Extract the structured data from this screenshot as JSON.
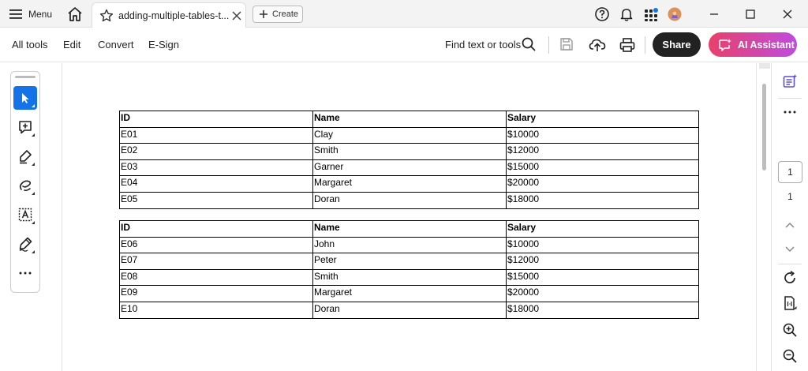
{
  "titlebar": {
    "menu_label": "Menu",
    "tab_title": "adding-multiple-tables-t...",
    "create_label": "Create",
    "icons": [
      "hamburger-icon",
      "home-icon",
      "star-icon",
      "close-icon",
      "plus-icon",
      "help-icon",
      "bell-icon",
      "apps-icon",
      "avatar",
      "minimize-icon",
      "maximize-icon",
      "window-close-icon"
    ]
  },
  "toolbar": {
    "menu_items": [
      "All tools",
      "Edit",
      "Convert",
      "E-Sign"
    ],
    "find_label": "Find text or tools",
    "share_label": "Share",
    "ai_label": "AI Assistant",
    "icons": [
      "search-icon",
      "save-icon",
      "upload-icon",
      "print-icon",
      "ai-chat-icon"
    ]
  },
  "left_rail": {
    "tools": [
      "select-cursor-icon",
      "add-comment-icon",
      "highlighter-icon",
      "draw-freeform-icon",
      "text-box-icon",
      "sign-pen-icon",
      "more-tools-icon"
    ],
    "active_tool": "select-cursor-icon"
  },
  "document": {
    "tables": [
      {
        "header": [
          "ID",
          "Name",
          "Salary"
        ],
        "rows": [
          [
            "E01",
            "Clay",
            "$10000"
          ],
          [
            "E02",
            "Smith",
            "$12000"
          ],
          [
            "E03",
            "Garner",
            "$15000"
          ],
          [
            "E04",
            "Margaret",
            "$20000"
          ],
          [
            "E05",
            "Doran",
            "$18000"
          ]
        ]
      },
      {
        "header": [
          "ID",
          "Name",
          "Salary"
        ],
        "rows": [
          [
            "E06",
            "John",
            "$10000"
          ],
          [
            "E07",
            "Peter",
            "$12000"
          ],
          [
            "E08",
            "Smith",
            "$15000"
          ],
          [
            "E09",
            "Margaret",
            "$20000"
          ],
          [
            "E10",
            "Doran",
            "$18000"
          ]
        ]
      }
    ]
  },
  "right_rail": {
    "current_page": "1",
    "total_pages": "1",
    "icons": [
      "ai-summary-icon",
      "more-options-icon",
      "page-up-icon",
      "page-down-icon",
      "rotate-icon",
      "fit-page-icon",
      "zoom-in-icon",
      "zoom-out-icon"
    ]
  },
  "colors": {
    "accent_blue": "#1473e6",
    "share_bg": "#222222",
    "ai_gradient_start": "#e8416a",
    "ai_gradient_end": "#c04be0"
  }
}
